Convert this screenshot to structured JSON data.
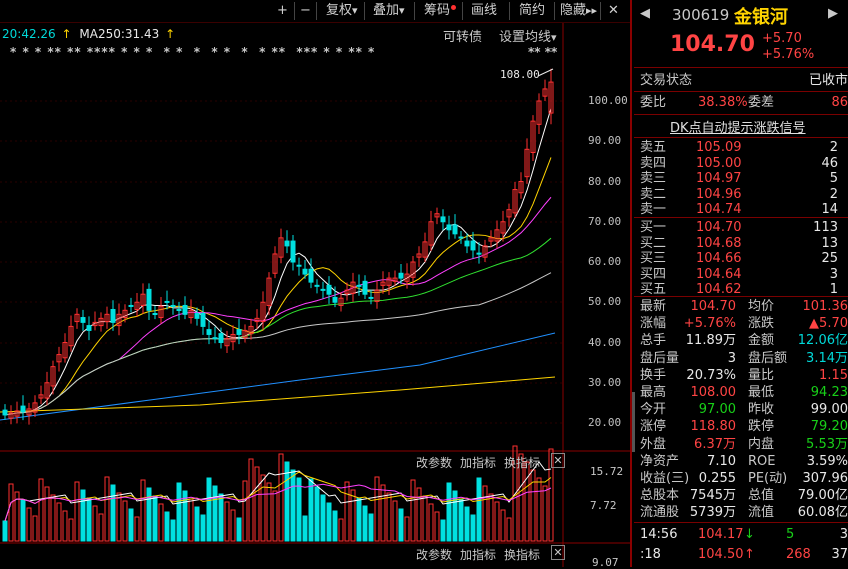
{
  "toolbar": {
    "plus": "+",
    "minus": "−",
    "fuquan": "复权",
    "diejia": "叠加",
    "chouma": "筹码",
    "huaxian": "画线",
    "jianyue": "简约",
    "yincang": "隐藏",
    "more": "▸▸",
    "dropdown_arrow": "▾",
    "close": "✕"
  },
  "main_chart": {
    "ma_partial": "20:42.26",
    "ma250": "MA250:31.43",
    "kezhuanzhai": "可转债",
    "shezhi": "设置均线",
    "high_marker": "108.00",
    "price_ticks": [
      "100.00",
      "90.00",
      "80.00",
      "70.00",
      "60.00",
      "50.00",
      "40.00",
      "30.00",
      "20.00"
    ],
    "stars_left": "* * * ** ** **** * * *  * *  *  * *  *  * **  *** * * ** *",
    "stars_right": "** **"
  },
  "vol_panel": {
    "gaicanshu": "改参数",
    "jiazhibiao": "加指标",
    "huanzhibiao": "换指标",
    "close": "✕",
    "ticks": [
      "15.72",
      "7.72"
    ]
  },
  "macd_panel": {
    "gaicanshu": "改参数",
    "jiazhibiao": "加指标",
    "huanzhibiao": "换指标",
    "close": "✕",
    "tick": "9.07"
  },
  "colors": {
    "up": "#ff3030",
    "down": "#00e0e0",
    "ma5": "#ffffff",
    "ma10": "#ffd400",
    "ma20": "#ff40ff",
    "ma60": "#30e030",
    "ma120": "#c8c8c8",
    "ma250a": "#2090ff",
    "ma250b": "#ffd400"
  },
  "stock": {
    "code": "300619",
    "name": "金银河",
    "price": "104.70",
    "change": "+5.70",
    "pct": "+5.76%"
  },
  "status": {
    "label": "交易状态",
    "value": "已收市"
  },
  "weibi": {
    "label": "委比",
    "value": "38.38%",
    "label2": "委差",
    "value2": "86"
  },
  "signal": "DK点自动提示涨跌信号",
  "asks": [
    {
      "label": "卖五",
      "price": "105.09",
      "vol": "2"
    },
    {
      "label": "卖四",
      "price": "105.00",
      "vol": "46"
    },
    {
      "label": "卖三",
      "price": "104.97",
      "vol": "5"
    },
    {
      "label": "卖二",
      "price": "104.96",
      "vol": "2"
    },
    {
      "label": "卖一",
      "price": "104.74",
      "vol": "14"
    }
  ],
  "bids": [
    {
      "label": "买一",
      "price": "104.70",
      "vol": "113"
    },
    {
      "label": "买二",
      "price": "104.68",
      "vol": "13"
    },
    {
      "label": "买三",
      "price": "104.66",
      "vol": "25"
    },
    {
      "label": "买四",
      "price": "104.64",
      "vol": "3"
    },
    {
      "label": "买五",
      "price": "104.62",
      "vol": "1"
    }
  ],
  "stats": [
    {
      "l1": "最新",
      "v1": "104.70",
      "c1": "red",
      "l2": "均价",
      "v2": "101.36",
      "c2": "red"
    },
    {
      "l1": "涨幅",
      "v1": "+5.76%",
      "c1": "red",
      "l2": "涨跌",
      "v2": "▲5.70",
      "c2": "red"
    },
    {
      "l1": "总手",
      "v1": "11.89万",
      "c1": "white",
      "l2": "金额",
      "v2": "12.06亿",
      "c2": "cyan"
    },
    {
      "l1": "盘后量",
      "v1": "3",
      "c1": "white",
      "l2": "盘后额",
      "v2": "3.14万",
      "c2": "cyan"
    },
    {
      "l1": "换手",
      "v1": "20.73%",
      "c1": "white",
      "l2": "量比",
      "v2": "1.15",
      "c2": "red"
    },
    {
      "l1": "最高",
      "v1": "108.00",
      "c1": "red",
      "l2": "最低",
      "v2": "94.23",
      "c2": "green"
    },
    {
      "l1": "今开",
      "v1": "97.00",
      "c1": "green",
      "l2": "昨收",
      "v2": "99.00",
      "c2": "white"
    },
    {
      "l1": "涨停",
      "v1": "118.80",
      "c1": "red",
      "l2": "跌停",
      "v2": "79.20",
      "c2": "green"
    },
    {
      "l1": "外盘",
      "v1": "6.37万",
      "c1": "red",
      "l2": "内盘",
      "v2": "5.53万",
      "c2": "green"
    },
    {
      "l1": "净资产",
      "v1": "7.10",
      "c1": "white",
      "l2": "ROE",
      "v2": "3.59%",
      "c2": "white"
    },
    {
      "l1": "收益(三)",
      "v1": "0.255",
      "c1": "white",
      "l2": "PE(动)",
      "v2": "307.96",
      "c2": "white"
    },
    {
      "l1": "总股本",
      "v1": "7545万",
      "c1": "white",
      "l2": "总值",
      "v2": "79.00亿",
      "c2": "white"
    },
    {
      "l1": "流通股",
      "v1": "5739万",
      "c1": "white",
      "l2": "流值",
      "v2": "60.08亿",
      "c2": "white"
    }
  ],
  "ticks": [
    {
      "time": "14:56",
      "price": "104.17",
      "arrow": "↓",
      "vol": "5",
      "num": "3",
      "pc": "red",
      "ac": "green",
      "vc": "green"
    },
    {
      "time": ":18",
      "price": "104.50",
      "arrow": "↑",
      "vol": "268",
      "num": "37",
      "pc": "red",
      "ac": "red",
      "vc": "red"
    }
  ]
}
